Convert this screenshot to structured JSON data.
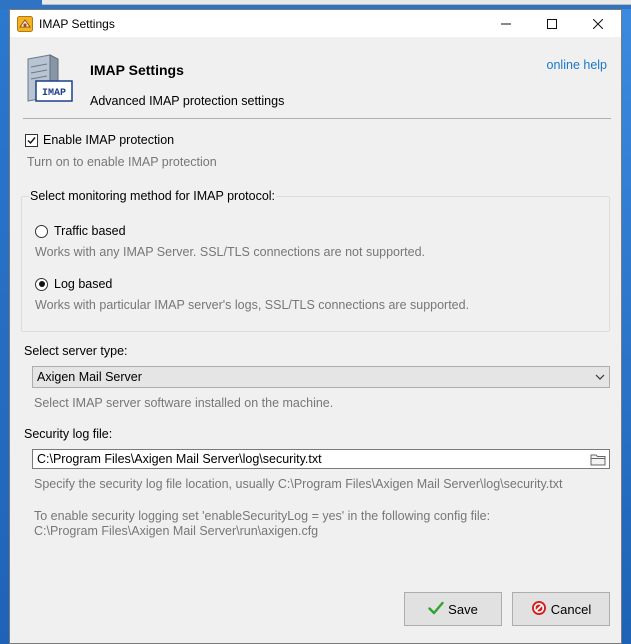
{
  "window": {
    "title": "IMAP Settings"
  },
  "header": {
    "title": "IMAP Settings",
    "subtitle": "Advanced IMAP protection settings",
    "help_link": "online help",
    "icon_label": "IMAP"
  },
  "enable": {
    "label": "Enable IMAP protection",
    "checked": true,
    "hint": "Turn on to enable IMAP protection"
  },
  "monitoring": {
    "group_label": "Select monitoring method for IMAP protocol:",
    "options": [
      {
        "label": "Traffic based",
        "hint": "Works with any IMAP Server. SSL/TLS connections are not supported.",
        "selected": false
      },
      {
        "label": "Log based",
        "hint": "Works with particular IMAP server's logs, SSL/TLS connections are supported.",
        "selected": true
      }
    ]
  },
  "server_type": {
    "label": "Select server type:",
    "value": "Axigen Mail Server",
    "hint": "Select IMAP server software installed on the machine."
  },
  "log_file": {
    "label": "Security log file:",
    "value": "C:\\Program Files\\Axigen Mail Server\\log\\security.txt",
    "hint": "Specify the security log file location, usually C:\\Program Files\\Axigen Mail Server\\log\\security.txt",
    "note_line1": "To enable security logging set 'enableSecurityLog = yes' in the following config file:",
    "note_line2": "C:\\Program Files\\Axigen Mail Server\\run\\axigen.cfg"
  },
  "buttons": {
    "save": "Save",
    "cancel": "Cancel"
  },
  "colors": {
    "link": "#1a78c8",
    "save_icon": "#2fa52f",
    "cancel_icon": "#d32020"
  }
}
